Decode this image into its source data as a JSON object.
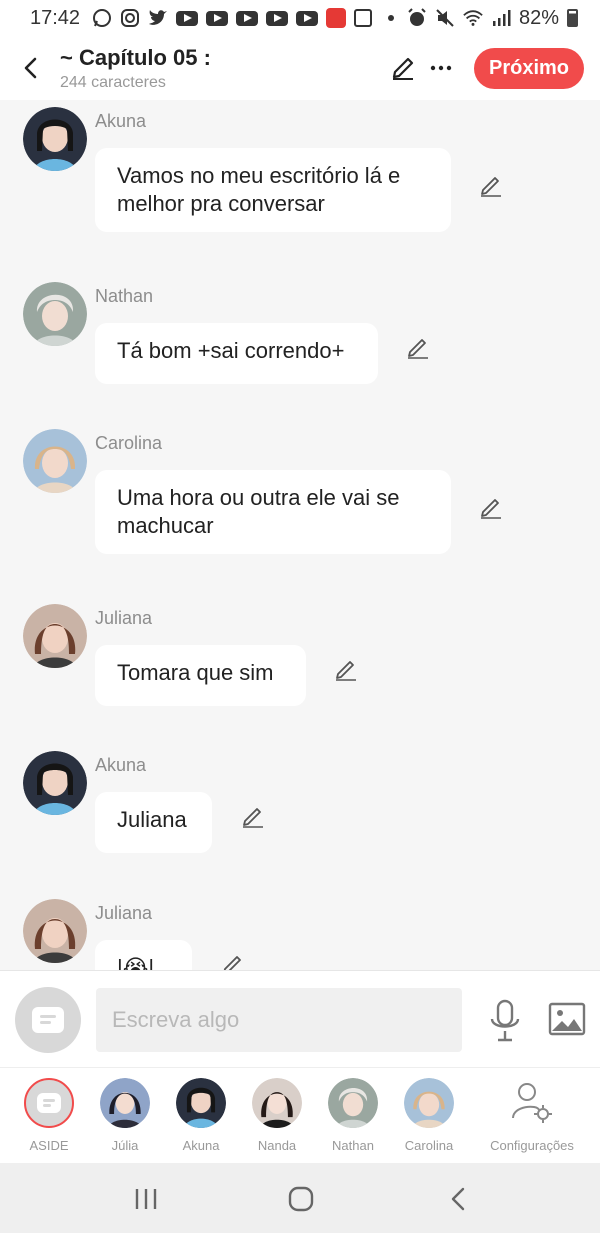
{
  "status_bar": {
    "time": "17:42",
    "battery": "82%"
  },
  "header": {
    "title": "~ Capítulo 05 :",
    "subtitle": "244 caracteres",
    "next_label": "Próximo"
  },
  "messages": [
    {
      "name": "Akuna",
      "text": "Vamos no meu escritório lá e melhor pra conversar"
    },
    {
      "name": "Nathan",
      "text": "Tá bom +sai correndo+"
    },
    {
      "name": "Carolina",
      "text": "Uma hora ou outra ele vai se machucar"
    },
    {
      "name": "Juliana",
      "text": "Tomara que sim"
    },
    {
      "name": "Akuna",
      "text": "Juliana"
    },
    {
      "name": "Juliana",
      "text": "|😭|"
    }
  ],
  "composer": {
    "placeholder": "Escreva algo"
  },
  "characters": [
    {
      "label": "ASIDE"
    },
    {
      "label": "Júlia"
    },
    {
      "label": "Akuna"
    },
    {
      "label": "Nanda"
    },
    {
      "label": "Nathan"
    },
    {
      "label": "Carolina"
    }
  ],
  "settings_label": "Configurações",
  "colors": {
    "accent": "#f14b4b",
    "background": "#f6f6f6",
    "bubble": "#ffffff"
  }
}
